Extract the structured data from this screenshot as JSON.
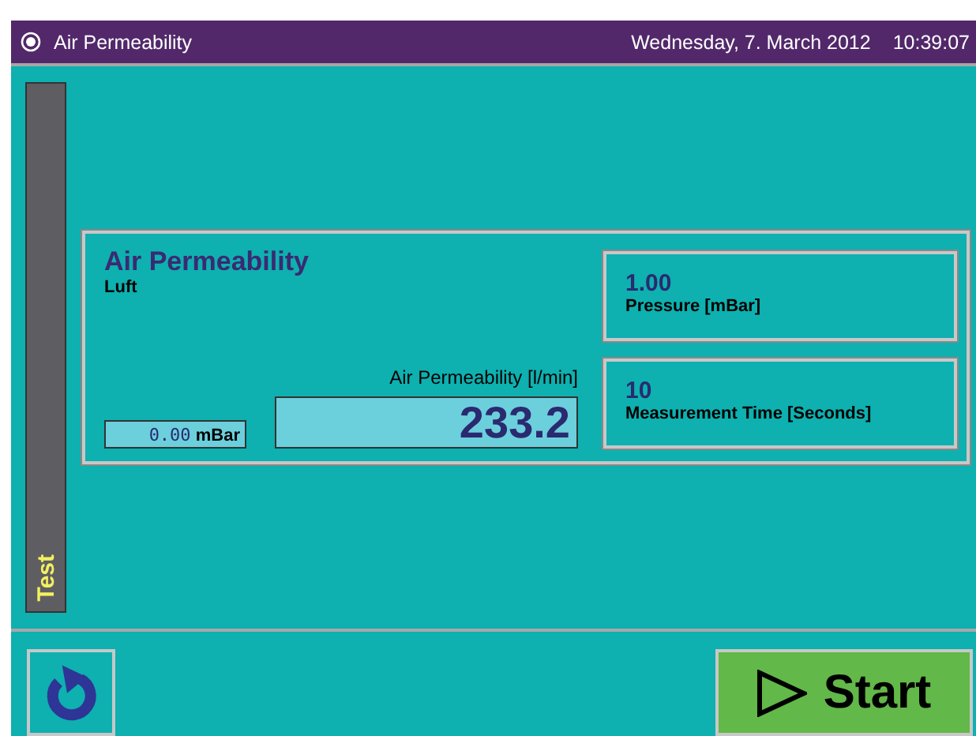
{
  "title_bar": {
    "title": "Air Permeability",
    "date": "Wednesday, 7. March 2012",
    "time": "10:39:07"
  },
  "side_tab": {
    "label": "Test"
  },
  "measurement": {
    "title": "Air Permeability",
    "subtitle": "Luft",
    "pressure_reading": {
      "value": "0.00",
      "unit": "mBar"
    },
    "result_label": "Air Permeability [l/min]",
    "result_value": "233.2"
  },
  "parameters": [
    {
      "value": "1.00",
      "label": "Pressure [mBar]"
    },
    {
      "value": "10",
      "label": "Measurement Time [Seconds]"
    }
  ],
  "buttons": {
    "start": "Start"
  }
}
